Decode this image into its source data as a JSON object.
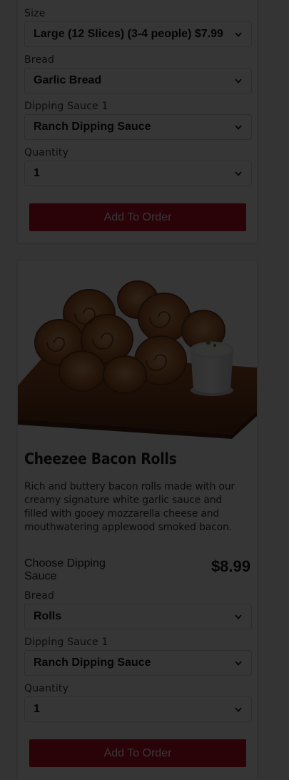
{
  "item1": {
    "fields": [
      {
        "label": "Size",
        "value": "Large (12 Slices) (3-4 people) $7.99"
      },
      {
        "label": "Bread",
        "value": "Garlic Bread"
      },
      {
        "label": "Dipping Sauce 1",
        "value": "Ranch Dipping Sauce"
      },
      {
        "label": "Quantity",
        "value": "1"
      }
    ],
    "add_button": "Add To Order"
  },
  "item2": {
    "title": "Cheezee Bacon Rolls",
    "description": "Rich and buttery bacon rolls made with our creamy signature white garlic sauce and filled with gooey mozzarella cheese and mouthwatering applewood smoked bacon.",
    "choose_label": "Choose Dipping Sauce",
    "price": "$8.99",
    "fields": [
      {
        "label": "Bread",
        "value": "Rolls"
      },
      {
        "label": "Dipping Sauce 1",
        "value": "Ranch Dipping Sauce"
      },
      {
        "label": "Quantity",
        "value": "1"
      }
    ],
    "add_button": "Add To Order"
  },
  "colors": {
    "accent": "#c8102e",
    "overlay": "rgba(0,0,0,0.79)"
  },
  "icons": {
    "select_arrow": "chevron-down-icon"
  }
}
